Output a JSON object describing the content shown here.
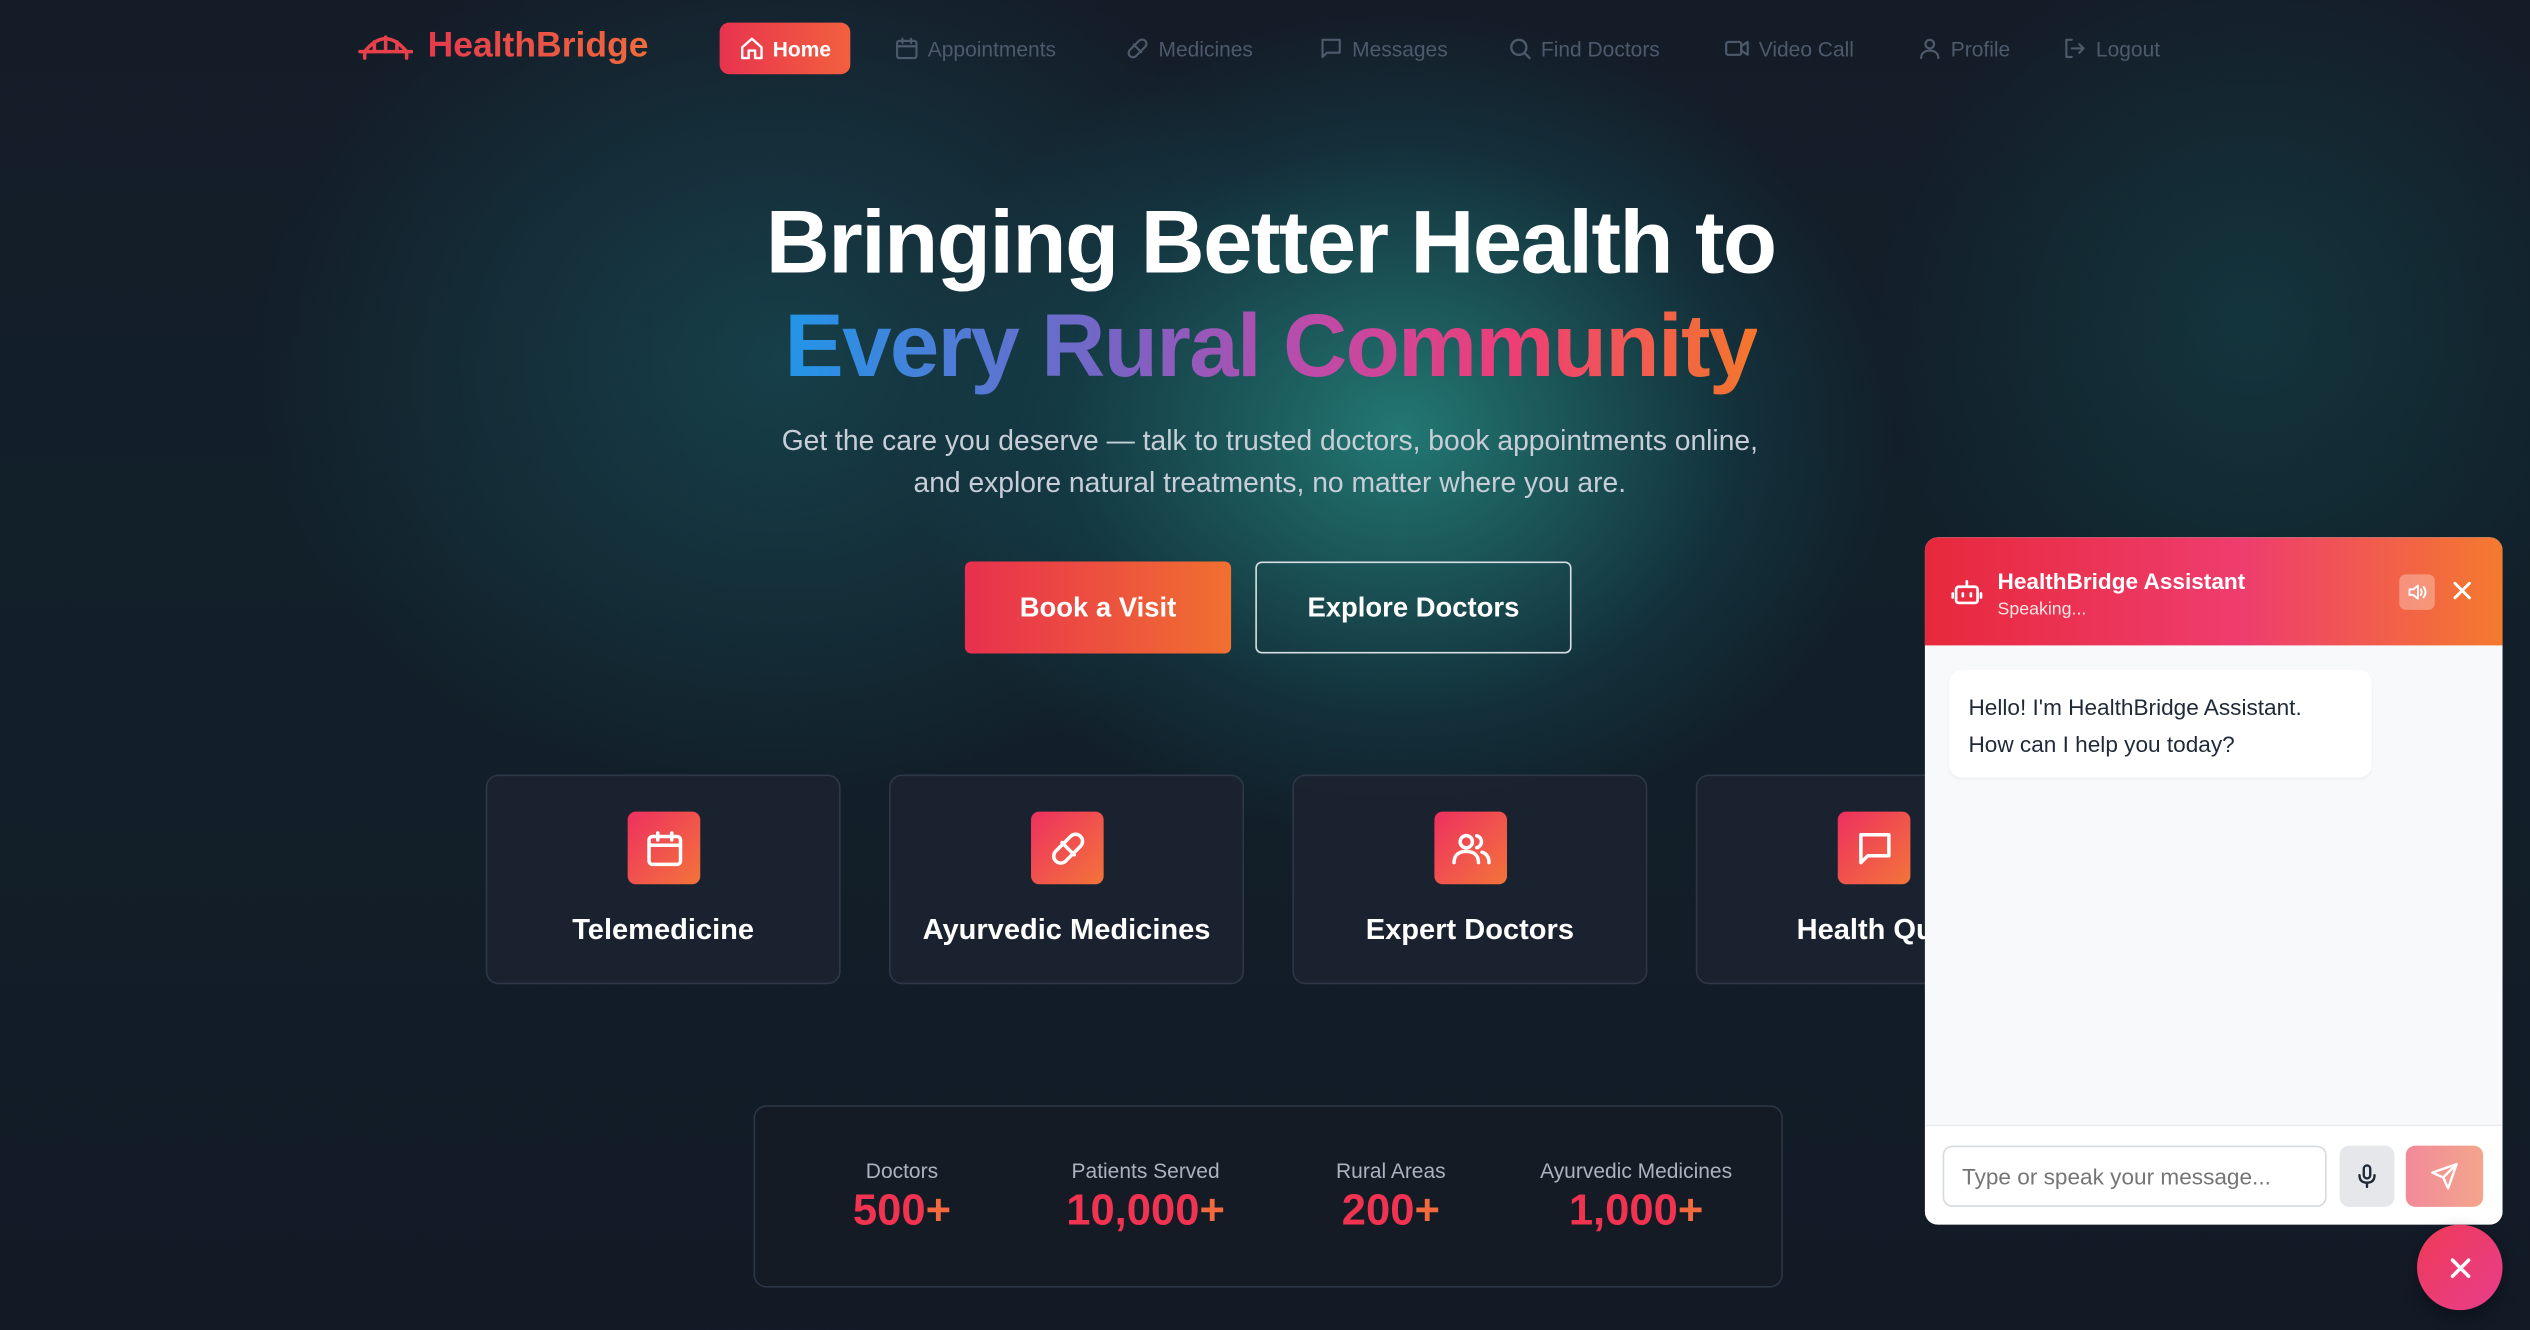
{
  "brand": {
    "name": "HealthBridge",
    "logo_icon": "bridge-icon"
  },
  "nav": {
    "items": [
      {
        "label": "Home",
        "icon": "home-icon",
        "active": true
      },
      {
        "label": "Appointments",
        "icon": "calendar-icon"
      },
      {
        "label": "Medicines",
        "icon": "pill-icon"
      },
      {
        "label": "Messages",
        "icon": "message-icon"
      },
      {
        "label": "Find Doctors",
        "icon": "search-icon"
      },
      {
        "label": "Video Call",
        "icon": "video-icon"
      },
      {
        "label": "Profile",
        "icon": "user-icon"
      },
      {
        "label": "Logout",
        "icon": "logout-icon"
      }
    ]
  },
  "hero": {
    "title_line1": "Bringing Better Health to",
    "title_line2": "Every Rural Community",
    "subtitle": "Get the care you deserve — talk to trusted doctors, book appointments online, and explore natural treatments, no matter where you are.",
    "primary_cta": "Book a Visit",
    "secondary_cta": "Explore Doctors"
  },
  "features": [
    {
      "label": "Telemedicine",
      "icon": "calendar-icon"
    },
    {
      "label": "Ayurvedic Medicines",
      "icon": "pill-icon"
    },
    {
      "label": "Expert Doctors",
      "icon": "users-icon"
    },
    {
      "label": "Health Que",
      "icon": "message-icon"
    }
  ],
  "stats": [
    {
      "label": "Doctors",
      "value": "500",
      "suffix": "+"
    },
    {
      "label": "Patients Served",
      "value": "10,000",
      "suffix": "+"
    },
    {
      "label": "Rural Areas",
      "value": "200",
      "suffix": "+"
    },
    {
      "label": "Ayurvedic Medicines",
      "value": "1,000",
      "suffix": "+"
    }
  ],
  "chat": {
    "title": "HealthBridge Assistant",
    "status": "Speaking...",
    "greeting": "Hello! I'm HealthBridge Assistant. How can I help you today?",
    "input_placeholder": "Type or speak your message..."
  },
  "colors": {
    "accent_start": "#e8344f",
    "accent_end": "#f2603e",
    "background": "#141c28"
  }
}
